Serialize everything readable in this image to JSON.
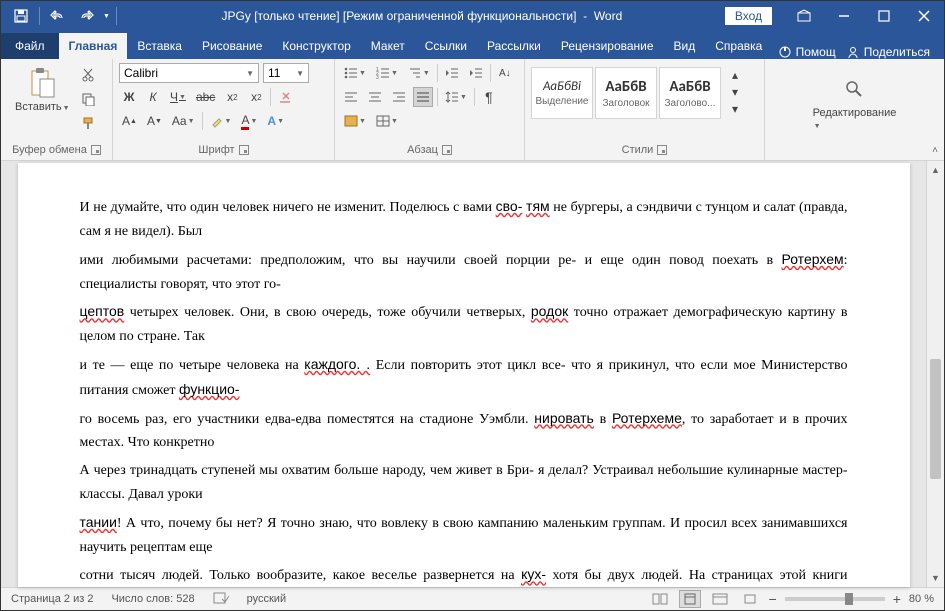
{
  "titlebar": {
    "doc_name": "JPGy",
    "readonly": "[только чтение]",
    "compat": "[Режим ограниченной функциональности]",
    "app": "Word",
    "login": "Вход"
  },
  "tabs": {
    "file": "Файл",
    "items": [
      "Главная",
      "Вставка",
      "Рисование",
      "Конструктор",
      "Макет",
      "Ссылки",
      "Рассылки",
      "Рецензирование",
      "Вид",
      "Справка"
    ],
    "active_index": 0,
    "help_hint": "Помощ",
    "share": "Поделиться"
  },
  "ribbon": {
    "clipboard": {
      "paste": "Вставить",
      "label": "Буфер обмена"
    },
    "font": {
      "name": "Calibri",
      "size": "11",
      "label": "Шрифт"
    },
    "paragraph": {
      "label": "Абзац"
    },
    "styles": {
      "label": "Стили",
      "items": [
        {
          "preview": "АаБбВі",
          "name": "Выделение"
        },
        {
          "preview": "АаБбВ",
          "name": "Заголовок"
        },
        {
          "preview": "АаБбВ",
          "name": "Заголово..."
        }
      ]
    },
    "editing": {
      "label": "Редактирование"
    }
  },
  "document": {
    "paragraphs": [
      "И не думайте, что один человек ничего не изменит. Поделюсь с вами <sp>сво-</sp> <sp>тям</sp> не бургеры, а сэндвичи с тунцом и салат (правда, сам я не видел). Был",
      "ими любимыми расчетами: предположим, что вы научили своей порции ре- и еще один повод поехать в <sp>Ротерхем</sp>: специалисты говорят, что этот го-",
      "<sp>цептов</sp> четырех человек. Они, в свою очередь, тоже обучили четверых, <sp>родок</sp> точно отражает демографическую картину в целом по стране. Так",
      "и те — еще по четыре человека на <sp>каждого. .</sp> Если повторить этот цикл все- что я прикинул, что если мое Министерство питания сможет <sp>функцио-</sp>",
      "го восемь раз, его участники едва-едва поместятся на стадионе Уэмбли. <sp>нировать</sp> в <sp>Ротерхеме</sp>, то заработает и в прочих местах. Что конкретно",
      "А через тринадцать ступеней мы охватим больше народу, чем живет в Бри- я делал? Устраивал небольшие кулинарные мастер-классы. Давал уроки",
      "<sp>тании</sp>! А что, почему бы нет? Я точно знаю, что вовлеку в свою кампанию маленьким группам. И просил всех занимавшихся научить рецептам еще",
      "сотни тысяч людей. Только вообразите, какое веселье развернется на <sp>кух-</sp> хотя бы двух людей. На страницах этой книги мелькают портреты моих"
    ]
  },
  "status": {
    "page": "Страница 2 из 2",
    "words": "Число слов: 528",
    "lang": "русский",
    "zoom": "80 %"
  }
}
